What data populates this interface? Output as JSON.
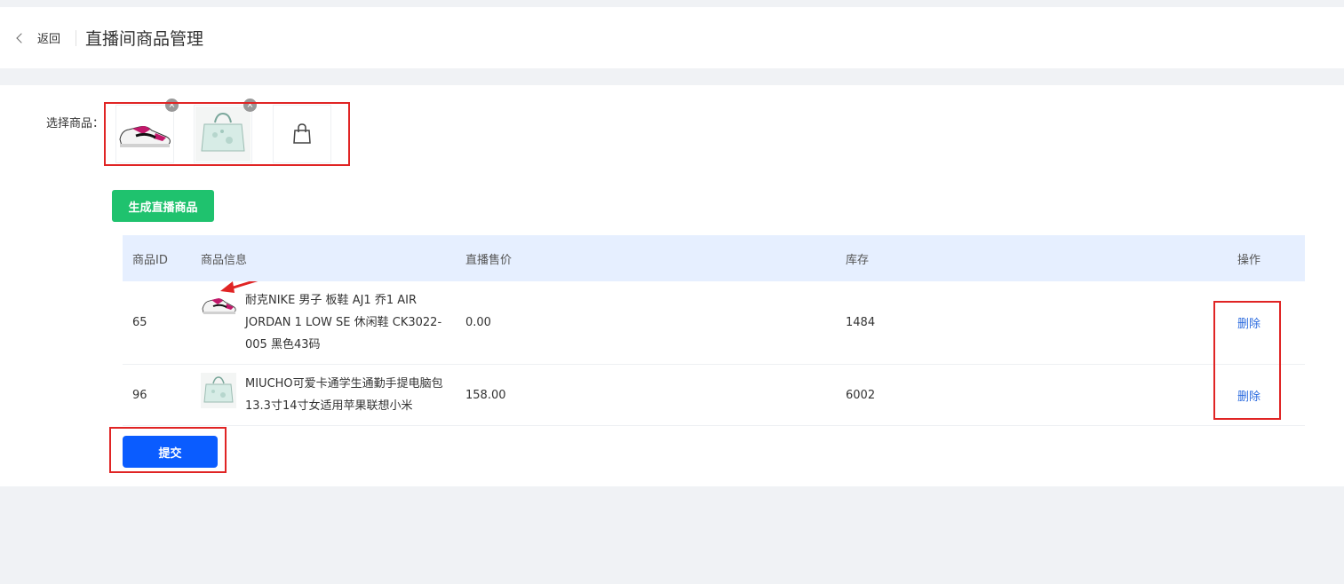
{
  "header": {
    "back_label": "返回",
    "title": "直播间商品管理"
  },
  "select": {
    "label": "选择商品：",
    "products": [
      {
        "name": "sneaker-thumbnail"
      },
      {
        "name": "tote-bag-thumbnail"
      }
    ],
    "add_icon": "shopping-bag-icon",
    "remove_glyph": "×"
  },
  "generate_button": "生成直播商品",
  "table": {
    "headers": [
      "商品ID",
      "商品信息",
      "直播售价",
      "库存",
      "操作"
    ],
    "rows": [
      {
        "id": "65",
        "info": "耐克NIKE 男子 板鞋 AJ1 乔1 AIR JORDAN 1 LOW SE 休闲鞋 CK3022-005 黑色43码",
        "price": "0.00",
        "stock": "1484",
        "action": "删除"
      },
      {
        "id": "96",
        "info": "MIUCHO可爱卡通学生通勤手提电脑包13.3寸14寸女适用苹果联想小米",
        "price": "158.00",
        "stock": "6002",
        "action": "删除"
      }
    ]
  },
  "submit_button": "提交",
  "colors": {
    "green": "#1fc26e",
    "blue": "#0a5cff",
    "link": "#2d6cdf",
    "highlight": "#e02424"
  }
}
